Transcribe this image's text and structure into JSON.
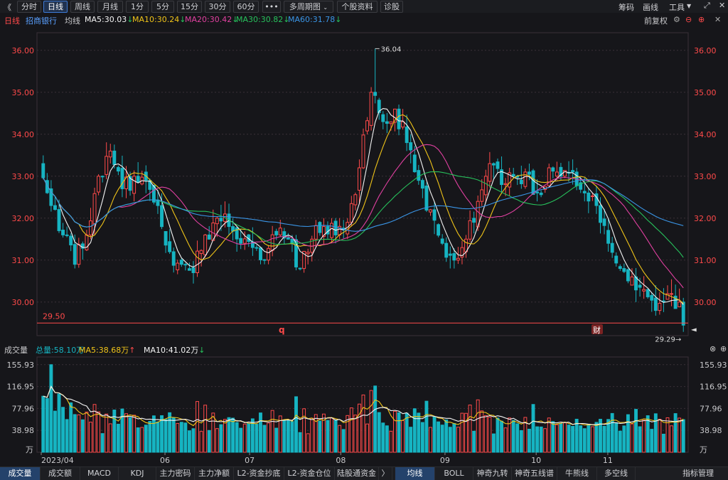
{
  "toolbar": {
    "back_glyph": "《",
    "periods": [
      "分时",
      "日线",
      "周线",
      "月线",
      "1分",
      "5分",
      "15分",
      "30分",
      "60分"
    ],
    "active_period": 1,
    "more": "•••",
    "multi_period": "多周期图",
    "profile": "个股资料",
    "diagnose": "诊股",
    "right": {
      "chips": "筹码",
      "draw": "画线",
      "tools": "工具"
    },
    "icons": [
      "chevron-down-icon",
      "settings-icon",
      "expand-icon",
      "close-icon"
    ]
  },
  "header": {
    "period_label": "日线",
    "stock_name": "招商银行",
    "ma_label": "均线",
    "ma": [
      {
        "name": "MA5",
        "value": "30.03",
        "dir": "down",
        "color": "#f4f4f4"
      },
      {
        "name": "MA10",
        "value": "30.24",
        "dir": "down",
        "color": "#f0c419"
      },
      {
        "name": "MA20",
        "value": "30.42",
        "dir": "down",
        "color": "#e040a0"
      },
      {
        "name": "MA30",
        "value": "30.82",
        "dir": "down",
        "color": "#27c15c"
      },
      {
        "name": "MA60",
        "value": "31.78",
        "dir": "down",
        "color": "#3a95e6"
      }
    ],
    "adjust": "前复权"
  },
  "colors": {
    "up": "#ff4a4a",
    "down": "#16b4c2",
    "grid": "#3a3038",
    "axis": "#ff4a4a"
  },
  "chart_data": [
    {
      "type": "candlestick",
      "title": "日线",
      "y_ticks": [
        "36.00",
        "35.00",
        "34.00",
        "33.00",
        "32.00",
        "31.00",
        "30.00"
      ],
      "ylim": [
        29.2,
        36.25
      ],
      "x_month_labels": [
        "2023/04",
        "06",
        "07",
        "08",
        "09",
        "10",
        "11"
      ],
      "annotations": {
        "high": "36.04",
        "low": "29.29",
        "support_line": "29.50",
        "marker_q": "q",
        "marker_cai": "财"
      },
      "ohlc_summary": [
        [
          33.3,
          33.9,
          32.1,
          32.3
        ],
        [
          32.3,
          32.6,
          31.4,
          31.6
        ],
        [
          31.6,
          31.8,
          30.6,
          30.9
        ],
        [
          30.9,
          31.8,
          30.7,
          31.6
        ],
        [
          31.6,
          33.4,
          31.5,
          33.0
        ],
        [
          33.0,
          34.2,
          32.6,
          33.6
        ],
        [
          33.6,
          33.8,
          32.5,
          32.7
        ],
        [
          32.7,
          33.4,
          32.4,
          33.0
        ],
        [
          33.0,
          33.4,
          32.5,
          32.9
        ],
        [
          32.9,
          33.1,
          32.1,
          32.3
        ],
        [
          32.3,
          32.6,
          31.0,
          31.2
        ],
        [
          31.2,
          31.4,
          30.6,
          30.9
        ],
        [
          30.9,
          31.2,
          30.4,
          30.7
        ],
        [
          30.7,
          31.8,
          30.6,
          31.6
        ],
        [
          31.6,
          32.3,
          31.5,
          32.0
        ],
        [
          32.0,
          32.4,
          31.6,
          31.8
        ],
        [
          31.8,
          32.0,
          31.2,
          31.4
        ],
        [
          31.4,
          31.8,
          31.1,
          31.3
        ],
        [
          31.3,
          31.6,
          30.9,
          31.0
        ],
        [
          31.0,
          31.9,
          30.9,
          31.6
        ],
        [
          31.6,
          32.0,
          31.3,
          31.5
        ],
        [
          31.5,
          31.6,
          30.7,
          30.8
        ],
        [
          30.8,
          31.6,
          30.7,
          31.5
        ],
        [
          31.5,
          32.0,
          31.3,
          31.8
        ],
        [
          31.8,
          32.0,
          31.4,
          31.6
        ],
        [
          31.6,
          32.0,
          31.5,
          31.9
        ],
        [
          31.9,
          33.4,
          31.8,
          33.2
        ],
        [
          33.2,
          35.6,
          33.0,
          35.0
        ],
        [
          35.0,
          36.04,
          34.0,
          34.3
        ],
        [
          34.3,
          34.9,
          33.7,
          34.6
        ],
        [
          34.6,
          34.8,
          33.6,
          33.8
        ],
        [
          33.8,
          34.0,
          32.7,
          32.9
        ],
        [
          32.9,
          33.2,
          32.0,
          32.2
        ],
        [
          32.2,
          32.4,
          31.2,
          31.4
        ],
        [
          31.4,
          31.6,
          30.8,
          31.0
        ],
        [
          31.0,
          31.6,
          30.9,
          31.5
        ],
        [
          31.5,
          32.6,
          31.4,
          32.4
        ],
        [
          32.4,
          33.6,
          32.2,
          33.3
        ],
        [
          33.3,
          33.5,
          32.6,
          32.8
        ],
        [
          32.8,
          33.2,
          32.5,
          33.0
        ],
        [
          33.0,
          33.4,
          32.7,
          33.1
        ],
        [
          33.1,
          33.3,
          32.4,
          32.6
        ],
        [
          32.6,
          33.3,
          32.5,
          33.2
        ],
        [
          33.2,
          33.4,
          32.9,
          33.0
        ],
        [
          33.0,
          33.4,
          32.8,
          33.1
        ],
        [
          33.1,
          33.2,
          32.4,
          32.6
        ],
        [
          32.6,
          32.9,
          32.1,
          32.3
        ],
        [
          32.3,
          32.5,
          31.2,
          31.4
        ],
        [
          31.4,
          31.6,
          30.6,
          30.8
        ],
        [
          30.8,
          31.2,
          30.4,
          30.6
        ],
        [
          30.6,
          31.0,
          30.0,
          30.3
        ],
        [
          30.3,
          30.6,
          29.6,
          29.8
        ],
        [
          29.8,
          30.4,
          29.7,
          30.2
        ],
        [
          30.2,
          30.6,
          29.9,
          30.0
        ],
        [
          30.0,
          30.2,
          29.29,
          29.45
        ]
      ]
    },
    {
      "type": "bar",
      "title": "成交量",
      "unit": "万",
      "y_ticks": [
        "155.93",
        "116.95",
        "77.96",
        "38.98"
      ],
      "ylim": [
        0,
        162
      ],
      "total": "总量:58.10万",
      "ma5": "MA5:38.68万",
      "ma10": "MA10:41.02万"
    }
  ],
  "volume_panel": {
    "label": "成交量",
    "total": "总量:58.10万",
    "ma5": "MA5:38.68万",
    "ma10": "MA10:41.02万",
    "unit": "万"
  },
  "bottom_tabs": {
    "left": [
      "成交量",
      "成交额",
      "MACD",
      "KDJ",
      "主力密码",
      "主力净额",
      "L2-资金抄底",
      "L2-资金仓位",
      "陆股通资金"
    ],
    "right": [
      "均线",
      "BOLL",
      "神奇九转",
      "神奇五线谱",
      "牛熊线",
      "多空线",
      "指标管理"
    ],
    "active_left": 0,
    "active_right": 0,
    "arrow": "〉"
  }
}
